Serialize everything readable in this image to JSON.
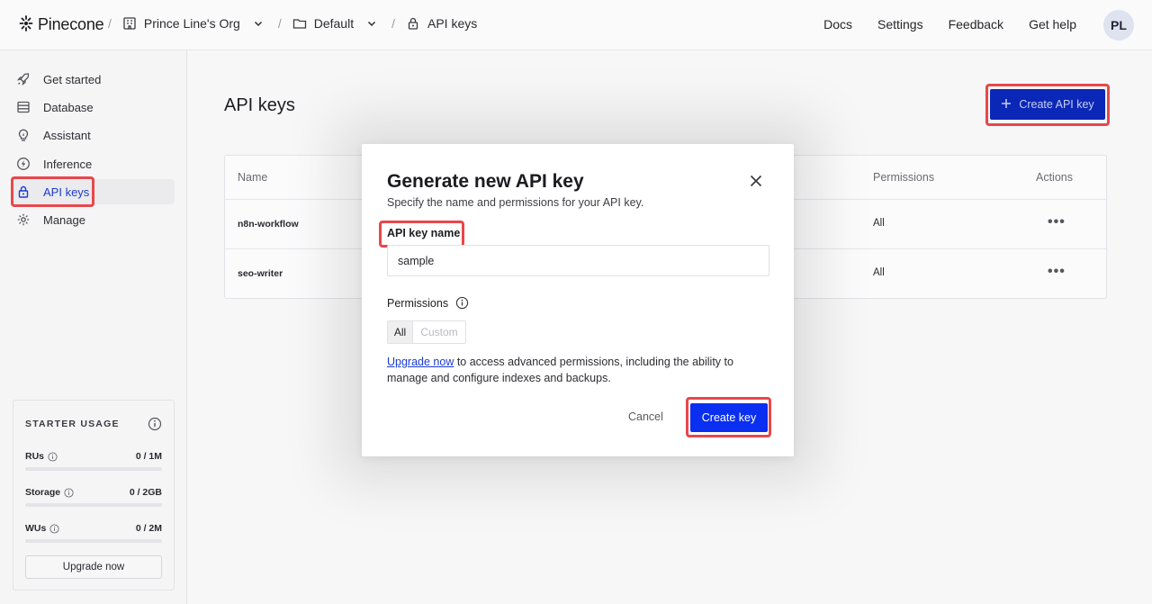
{
  "brand": {
    "name": "Pinecone"
  },
  "breadcrumb": {
    "org": "Prince Line's Org",
    "project": "Default",
    "page": "API keys"
  },
  "topnav": {
    "docs": "Docs",
    "settings": "Settings",
    "feedback": "Feedback",
    "help": "Get help"
  },
  "user": {
    "initials": "PL"
  },
  "sidebar": {
    "items": [
      {
        "label": "Get started",
        "icon": "rocket-icon"
      },
      {
        "label": "Database",
        "icon": "database-icon"
      },
      {
        "label": "Assistant",
        "icon": "lightbulb-icon"
      },
      {
        "label": "Inference",
        "icon": "bolt-icon"
      },
      {
        "label": "API keys",
        "icon": "lock-icon",
        "active": true
      },
      {
        "label": "Manage",
        "icon": "gear-icon"
      }
    ],
    "usage": {
      "title": "STARTER USAGE",
      "rows": [
        {
          "label": "RUs",
          "value": "0 / 1M",
          "fill": 0
        },
        {
          "label": "Storage",
          "value": "0 / 2GB",
          "fill": 0
        },
        {
          "label": "WUs",
          "value": "0 / 2M",
          "fill": 0
        }
      ],
      "upgrade_label": "Upgrade now"
    }
  },
  "main": {
    "title": "API keys",
    "create_button": "Create API key",
    "table": {
      "headers": {
        "name": "Name",
        "permissions": "Permissions",
        "actions": "Actions"
      },
      "rows": [
        {
          "name": "n8n-workflow",
          "permissions": "All"
        },
        {
          "name": "seo-writer",
          "permissions": "All"
        }
      ]
    }
  },
  "modal": {
    "title": "Generate new API key",
    "subtitle": "Specify the name and permissions for your API key.",
    "name_label": "API key name",
    "name_value": "sample",
    "permissions_label": "Permissions",
    "permission_options": {
      "all": "All",
      "custom": "Custom"
    },
    "upgrade_link": "Upgrade now",
    "upgrade_text": " to access advanced permissions, including the ability to manage and configure indexes and backups.",
    "cancel_label": "Cancel",
    "create_label": "Create key"
  },
  "colors": {
    "accent": "#0a2ff0",
    "highlight": "#e8474b",
    "active_nav": "#1a3bd1"
  }
}
